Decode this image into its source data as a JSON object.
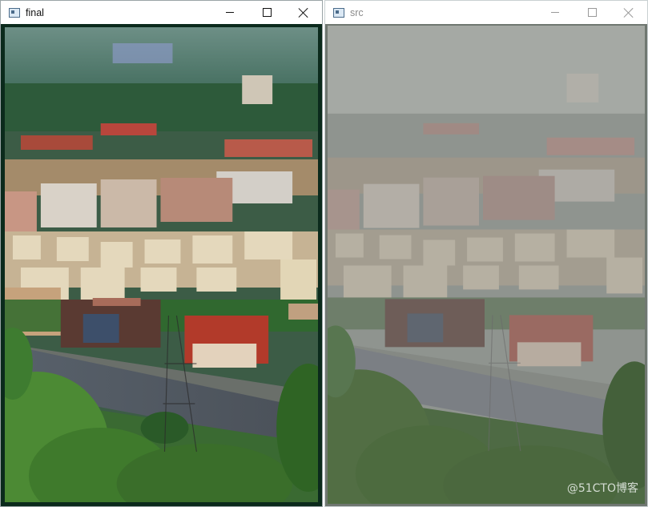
{
  "windows": {
    "final": {
      "title": "final",
      "image_alt": "Dehazed city view"
    },
    "src": {
      "title": "src",
      "image_alt": "Hazy city view"
    }
  },
  "icons": {
    "app": "app-window-icon",
    "minimize": "minimize-icon",
    "maximize": "maximize-icon",
    "close": "close-icon"
  },
  "colors": {
    "final_sky": "#5f8a7a",
    "final_trees": "#2f6e2c",
    "final_buildings": "#b8a58c",
    "src_haze": "#9ea39f"
  },
  "watermark": "@51CTO博客"
}
